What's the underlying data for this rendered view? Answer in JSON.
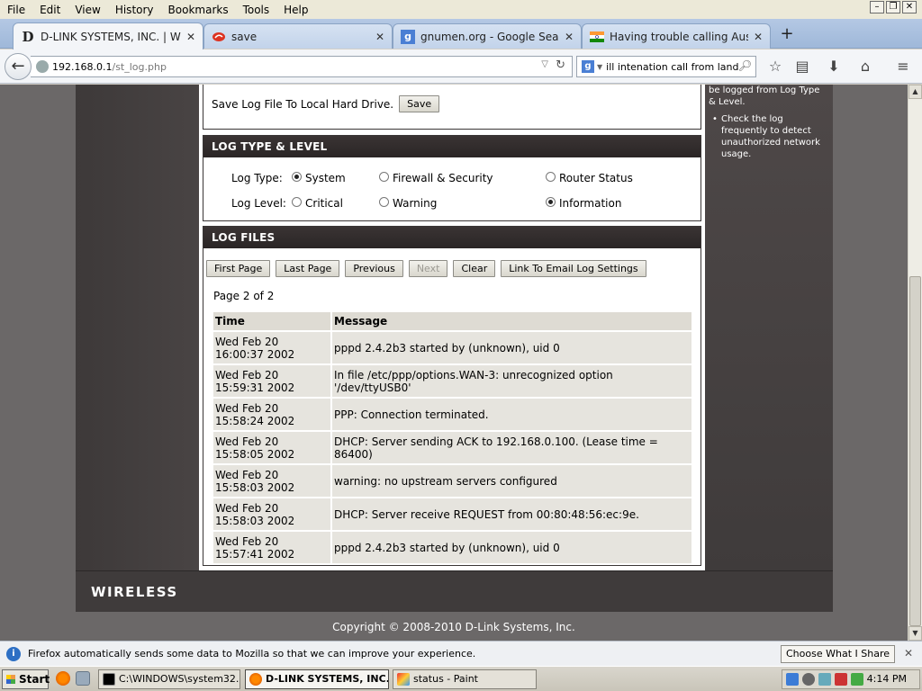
{
  "menu": [
    "File",
    "Edit",
    "View",
    "History",
    "Bookmarks",
    "Tools",
    "Help"
  ],
  "tabs": [
    {
      "title": "D-LINK SYSTEMS, INC. | WIR...",
      "fav": "D"
    },
    {
      "title": "save",
      "fav": ""
    },
    {
      "title": "gnumen.org - Google Search",
      "fav": "g"
    },
    {
      "title": "Having trouble calling Australi...",
      "fav": ""
    }
  ],
  "nav": {
    "url_host": "192.168.0.1",
    "url_path": "/st_log.php",
    "search_value": "ill intenation call from land line"
  },
  "sidebar_hints": [
    "be logged from Log Type & Level.",
    "Check the log frequently to detect unauthorized network usage."
  ],
  "save_section": {
    "label": "Save Log File To Local Hard Drive.",
    "button": "Save"
  },
  "log_type_section": {
    "header": "LOG TYPE & LEVEL",
    "type_label": "Log Type:",
    "level_label": "Log Level:",
    "types": [
      {
        "label": "System",
        "checked": true
      },
      {
        "label": "Firewall & Security",
        "checked": false
      },
      {
        "label": "Router Status",
        "checked": false
      }
    ],
    "levels": [
      {
        "label": "Critical",
        "checked": false
      },
      {
        "label": "Warning",
        "checked": false
      },
      {
        "label": "Information",
        "checked": true
      }
    ]
  },
  "log_files_section": {
    "header": "LOG FILES",
    "buttons": [
      "First Page",
      "Last Page",
      "Previous",
      "Next",
      "Clear",
      "Link To Email Log Settings"
    ],
    "page_info": "Page 2 of 2",
    "columns": [
      "Time",
      "Message"
    ],
    "rows": [
      {
        "time": "Wed Feb 20 16:00:37 2002",
        "message": "pppd 2.4.2b3 started by (unknown), uid 0"
      },
      {
        "time": "Wed Feb 20 15:59:31 2002",
        "message": "In file /etc/ppp/options.WAN-3: unrecognized option '/dev/ttyUSB0'"
      },
      {
        "time": "Wed Feb 20 15:58:24 2002",
        "message": "PPP: Connection terminated."
      },
      {
        "time": "Wed Feb 20 15:58:05 2002",
        "message": "DHCP: Server sending ACK to 192.168.0.100. (Lease time = 86400)"
      },
      {
        "time": "Wed Feb 20 15:58:03 2002",
        "message": "warning: no upstream servers configured"
      },
      {
        "time": "Wed Feb 20 15:58:03 2002",
        "message": "DHCP: Server receive REQUEST from 00:80:48:56:ec:9e."
      },
      {
        "time": "Wed Feb 20 15:57:41 2002",
        "message": "pppd 2.4.2b3 started by (unknown), uid 0"
      }
    ]
  },
  "footer": {
    "brand": "WIRELESS",
    "copyright": "Copyright © 2008-2010 D-Link Systems, Inc."
  },
  "notification": {
    "text": "Firefox automatically sends some data to Mozilla so that we can improve your experience.",
    "button": "Choose What I Share"
  },
  "taskbar": {
    "start": "Start",
    "tasks": [
      "C:\\WINDOWS\\system32...",
      "D-LINK SYSTEMS, INC. ...",
      "status - Paint"
    ],
    "clock": "4:14 PM"
  }
}
